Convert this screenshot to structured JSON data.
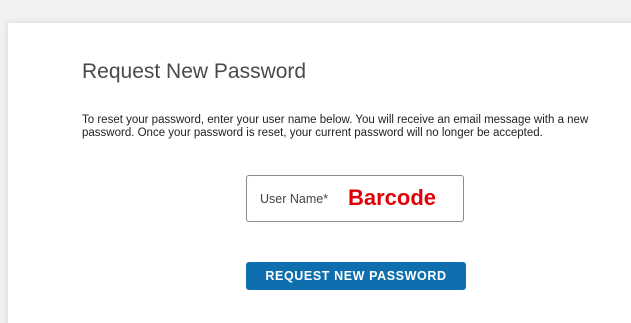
{
  "form": {
    "title": "Request New Password",
    "description": "To reset your password, enter your user name below. You will receive an email message with a new password. Once your password is reset, your current password will no longer be accepted.",
    "username_label": "User Name*",
    "username_value": "Barcode",
    "submit_label": "REQUEST NEW PASSWORD"
  },
  "colors": {
    "button_background": "#0f6fae",
    "field_value_text": "#e0000a",
    "page_background": "#f1f1f1"
  }
}
